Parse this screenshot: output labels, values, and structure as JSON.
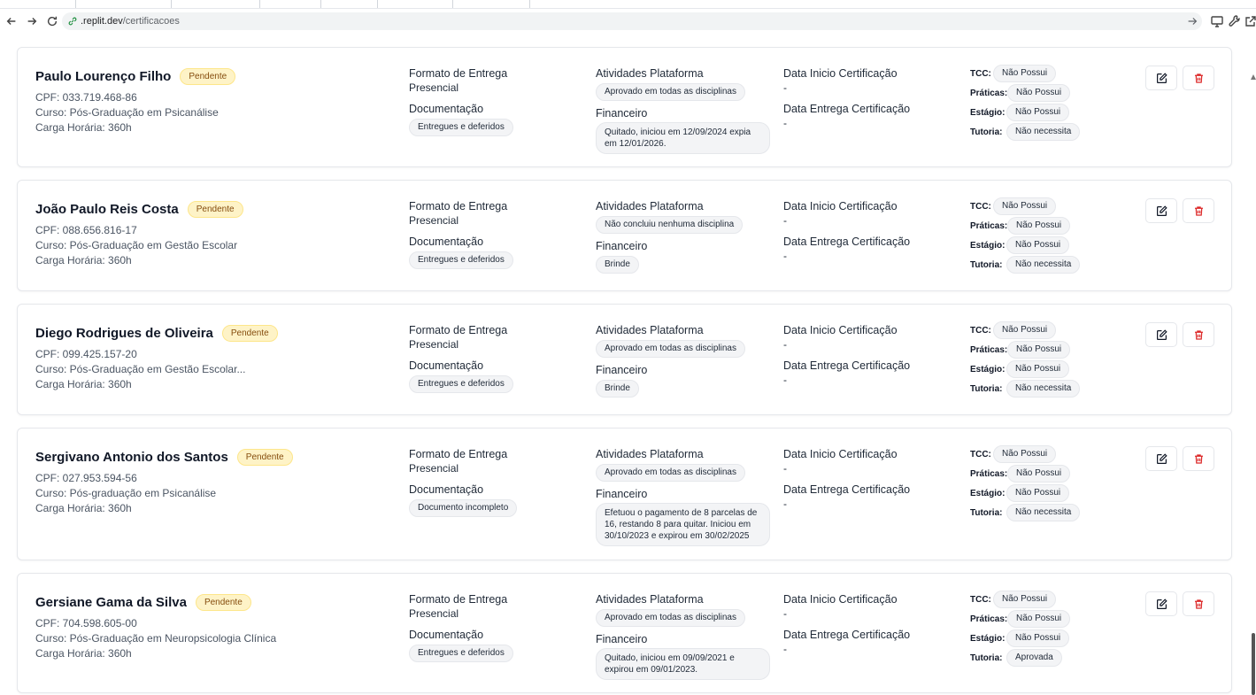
{
  "browser": {
    "url_host": ".replit.dev",
    "url_path": "/certificacoes"
  },
  "labels": {
    "formato": "Formato de Entrega",
    "documentacao": "Documentação",
    "atividades": "Atividades Plataforma",
    "financeiro": "Financeiro",
    "data_inicio": "Data Inicio Certificação",
    "data_entrega": "Data Entrega Certificação",
    "tcc": "TCC:",
    "praticas": "Práticas:",
    "estagio": "Estágio:",
    "tutoria": "Tutoria:"
  },
  "records": [
    {
      "name": "Paulo Lourenço Filho",
      "status": "Pendente",
      "cpf": "CPF: 033.719.468-86",
      "curso": "Curso: Pós-Graduação em Psicanálise",
      "carga": "Carga Horária: 360h",
      "formato": "Presencial",
      "documentacao": "Entregues e deferidos",
      "atividades": "Aprovado em todas as disciplinas",
      "financeiro": "Quitado, iniciou em 12/09/2024 expia em 12/01/2026.",
      "data_inicio": "-",
      "data_entrega": "-",
      "tcc": "Não Possui",
      "praticas": "Não Possui",
      "estagio": "Não Possui",
      "tutoria": "Não necessita"
    },
    {
      "name": "João Paulo Reis Costa",
      "status": "Pendente",
      "cpf": "CPF: 088.656.816-17",
      "curso": "Curso: Pós-Graduação em Gestão Escolar",
      "carga": "Carga Horária: 360h",
      "formato": "Presencial",
      "documentacao": "Entregues e deferidos",
      "atividades": "Não concluiu nenhuma disciplina",
      "financeiro": "Brinde",
      "data_inicio": "-",
      "data_entrega": "-",
      "tcc": "Não Possui",
      "praticas": "Não Possui",
      "estagio": "Não Possui",
      "tutoria": "Não necessita"
    },
    {
      "name": "Diego Rodrigues de Oliveira",
      "status": "Pendente",
      "cpf": "CPF: 099.425.157-20",
      "curso": "Curso: Pós-Graduação em Gestão Escolar...",
      "carga": "Carga Horária: 360h",
      "formato": "Presencial",
      "documentacao": "Entregues e deferidos",
      "atividades": "Aprovado em todas as disciplinas",
      "financeiro": "Brinde",
      "data_inicio": "-",
      "data_entrega": "-",
      "tcc": "Não Possui",
      "praticas": "Não Possui",
      "estagio": "Não Possui",
      "tutoria": "Não necessita"
    },
    {
      "name": "Sergivano Antonio dos Santos",
      "status": "Pendente",
      "cpf": "CPF: 027.953.594-56",
      "curso": "Curso: Pós-graduação em Psicanálise",
      "carga": "Carga Horária: 360h",
      "formato": "Presencial",
      "documentacao": "Documento incompleto",
      "atividades": "Aprovado em todas as disciplinas",
      "financeiro": "Efetuou o pagamento de 8 parcelas de 16, restando 8 para quitar. Iniciou em 30/10/2023 e expirou em 30/02/2025",
      "data_inicio": "-",
      "data_entrega": "-",
      "tcc": "Não Possui",
      "praticas": "Não Possui",
      "estagio": "Não Possui",
      "tutoria": "Não necessita"
    },
    {
      "name": "Gersiane Gama da Silva",
      "status": "Pendente",
      "cpf": "CPF: 704.598.605-00",
      "curso": "Curso: Pós-Graduação em Neuropsicologia Clínica",
      "carga": "Carga Horária: 360h",
      "formato": "Presencial",
      "documentacao": "Entregues e deferidos",
      "atividades": "Aprovado em todas as disciplinas",
      "financeiro": "Quitado, iniciou em 09/09/2021 e expirou em 09/01/2023.",
      "data_inicio": "-",
      "data_entrega": "-",
      "tcc": "Não Possui",
      "praticas": "Não Possui",
      "estagio": "Não Possui",
      "tutoria": "Aprovada"
    }
  ],
  "colors": {
    "status_bg": "#fef3c7",
    "delete_icon": "#dc2626"
  }
}
